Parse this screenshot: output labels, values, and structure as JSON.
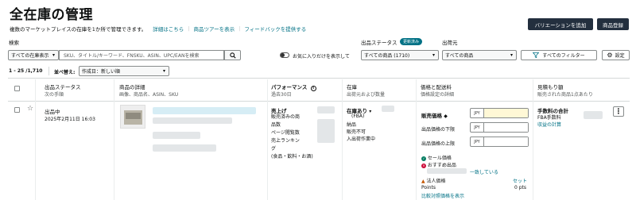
{
  "header": {
    "title": "全在庫の管理",
    "subtitle": "複数のマーケットプレイスの在庫を1か所で管理できます。",
    "links": [
      "詳細はこちら",
      "商品ツアーを表示",
      "フィードバックを提供する"
    ],
    "add_variation_label": "バリエーションを追加",
    "add_product_label": "商品登録"
  },
  "search": {
    "label": "検索",
    "scope_value": "すべての在庫表示",
    "placeholder": "SKU、タイトル/キーワード、FNSKU、ASIN、UPC/EANを検索",
    "favorites_label": "お気に入りだけを表示して"
  },
  "filters": {
    "status_label": "出品ステータス",
    "status_badge": "更新済み",
    "status_value": "すべての商品 (1710)",
    "shipping_label": "出荷元",
    "shipping_value": "すべての商品",
    "all_filters_label": "すべてのフィルター",
    "settings_label": "設定"
  },
  "results": {
    "range": "1 - 25 /1,710",
    "sort_label": "並べ替え:",
    "sort_value": "作成日：新しい順"
  },
  "columns": [
    {
      "title": "出品ステータス",
      "sub": "次の手順"
    },
    {
      "title": "商品の詳細",
      "sub": "画像、商品名、ASIN、SKU"
    },
    {
      "title": "パフォーマンス",
      "sub": "過去30日"
    },
    {
      "title": "在庫",
      "sub": "出荷元および数量"
    },
    {
      "title": "価格と配送料",
      "sub": "価格設定の詳細"
    },
    {
      "title": "見積もり額",
      "sub": "販売された商品1点あたり"
    }
  ],
  "row": {
    "status": "出品中",
    "date": "2025年2月11日 16:03",
    "performance": {
      "title": "売上げ",
      "lines": [
        "販売済みの商",
        "品数",
        "ページ閲覧数",
        "売上ランキン",
        "グ",
        "(食品・飲料・お酒)"
      ]
    },
    "inventory": {
      "title": "在庫あり",
      "fba": "(FBA)",
      "lines": [
        "納品",
        "販売不可",
        "入出荷作業中"
      ]
    },
    "pricing": {
      "sale_price_label": "販売価格",
      "min_price_label": "出品価格の下限",
      "max_price_label": "出品価格の上限",
      "currency": "JPY",
      "sale_price_status": "セール価格",
      "recommended_label": "おすすめ出品",
      "match_label": "一致している",
      "corporate_price_label": "法人価格",
      "corporate_price_value": "セット",
      "points_label": "Points",
      "points_value": "0 pts",
      "compare_label": "比較対照価格を表示"
    },
    "estimate": {
      "title": "手数料の合計",
      "fba_fee": "FBA手数料",
      "income_link": "収益の計算"
    },
    "more_label": "⋮"
  },
  "colors": {
    "dark_button": "#232f3e",
    "link": "#007185",
    "badge": "#007185",
    "highlight": "#fff8d6"
  }
}
